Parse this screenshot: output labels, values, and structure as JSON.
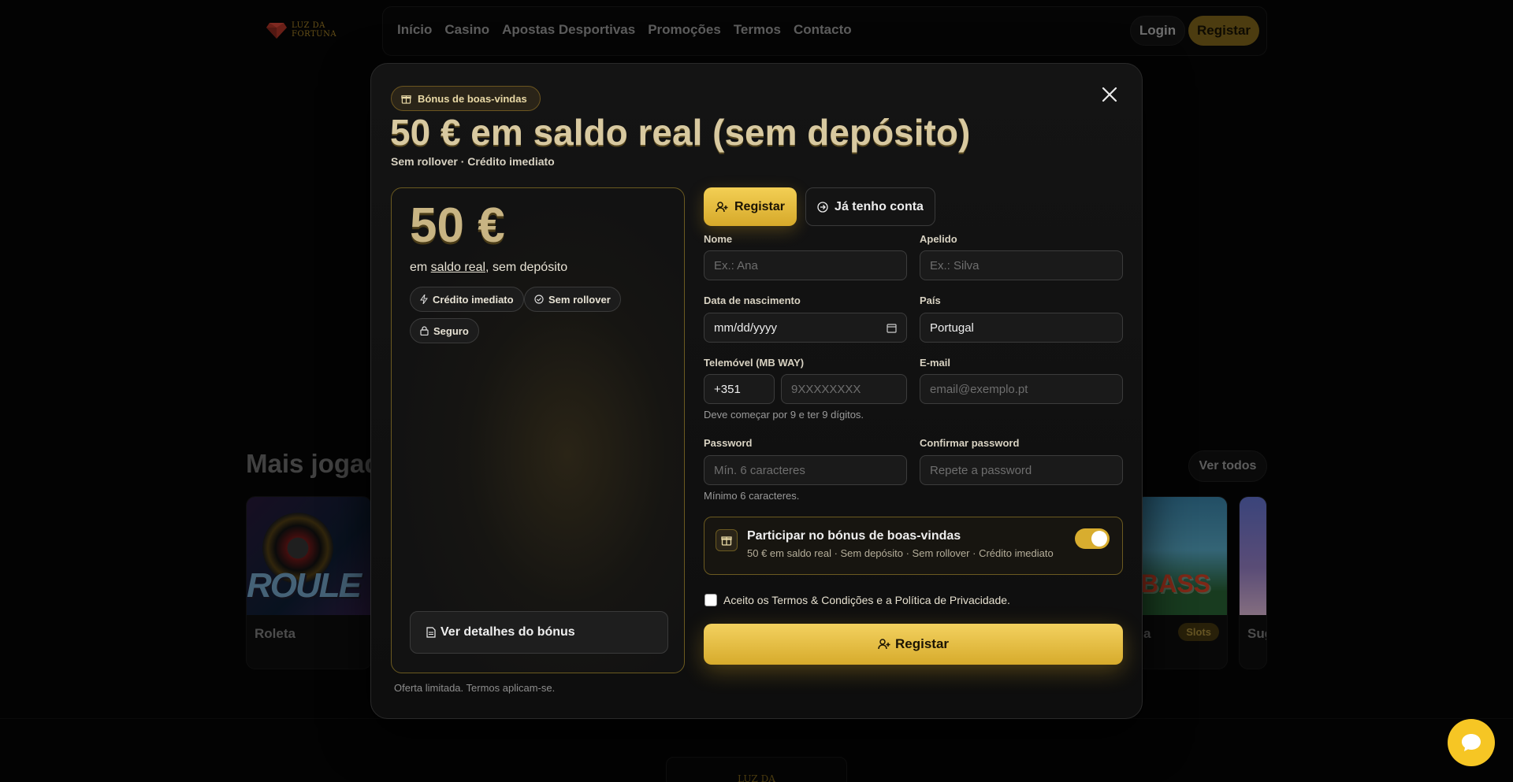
{
  "brand": {
    "name_line1": "LUZ DA",
    "name_line2": "FORTUNA"
  },
  "nav": {
    "links": [
      "Início",
      "Casino",
      "Apostas Desportivas",
      "Promoções",
      "Termos",
      "Contacto"
    ],
    "login": "Login",
    "register": "Registar"
  },
  "background": {
    "section_title": "Mais jogados",
    "see_all": "Ver todos",
    "games": [
      {
        "name": "Roleta",
        "art_text": "ROULE"
      },
      {
        "name": "a",
        "art_text": "BASS",
        "tag": "Slots"
      },
      {
        "name": "Sug"
      }
    ],
    "footer_brand": "LUZ DA"
  },
  "modal": {
    "badge": "Bónus de boas-vindas",
    "title": "50 € em saldo real (sem depósito)",
    "subtitle": "Sem rollover · Crédito imediato",
    "bonus": {
      "amount": "50 €",
      "line_prefix": "em ",
      "line_underlined": "saldo real",
      "line_suffix": ", sem depósito",
      "chips": [
        "Crédito imediato",
        "Sem rollover",
        "Seguro"
      ],
      "details_button": "Ver detalhes do bónus"
    },
    "footnote": "Oferta limitada. Termos aplicam-se.",
    "tabs": {
      "register": "Registar",
      "login": "Já tenho conta"
    },
    "form": {
      "first_name": {
        "label": "Nome",
        "placeholder": "Ex.: Ana"
      },
      "last_name": {
        "label": "Apelido",
        "placeholder": "Ex.: Silva"
      },
      "dob": {
        "label": "Data de nascimento",
        "value": "mm/dd/yyyy"
      },
      "country": {
        "label": "País",
        "value": "Portugal"
      },
      "phone": {
        "label": "Telemóvel (MB WAY)",
        "prefix": "+351",
        "placeholder": "9XXXXXXXX",
        "hint": "Deve começar por 9 e ter 9 dígitos."
      },
      "email": {
        "label": "E-mail",
        "placeholder": "email@exemplo.pt"
      },
      "password": {
        "label": "Password",
        "placeholder": "Mín. 6 caracteres",
        "hint": "Mínimo 6 caracteres."
      },
      "confirm_password": {
        "label": "Confirmar password",
        "placeholder": "Repete a password"
      },
      "bonus_opt_in": {
        "title": "Participar no bónus de boas-vindas",
        "subtitle": "50 € em saldo real · Sem depósito · Sem rollover · Crédito imediato",
        "enabled": true
      },
      "terms": {
        "label": "Aceito os Termos & Condições e a Política de Privacidade.",
        "checked": false
      },
      "submit": "Registar"
    }
  },
  "colors": {
    "gold": "#d8ad2f",
    "gold_light": "#f3cf54",
    "background": "#060606"
  }
}
